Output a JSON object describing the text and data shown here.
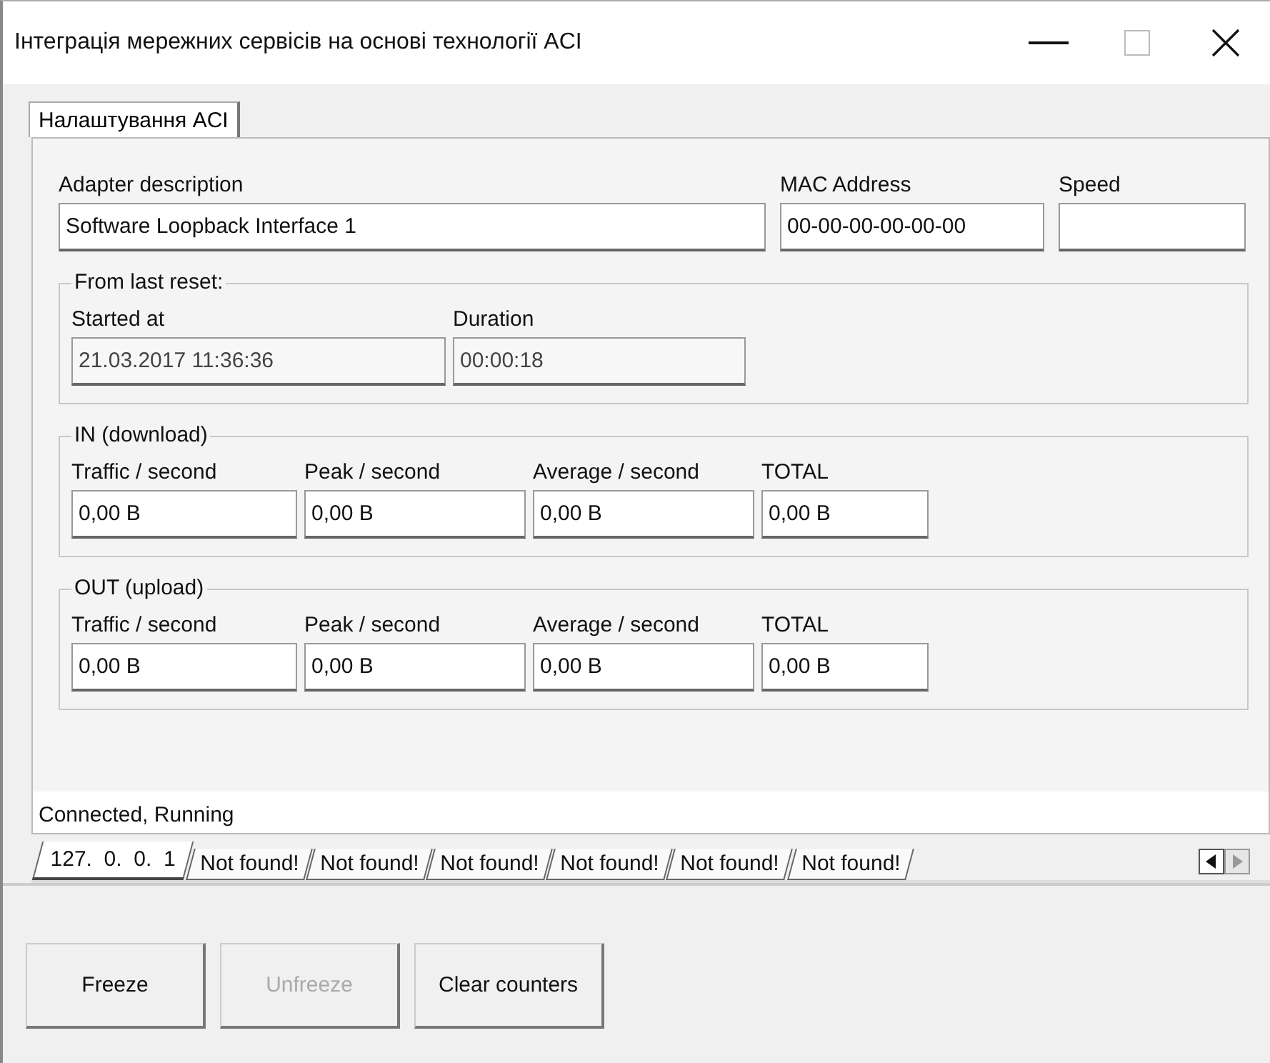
{
  "window": {
    "title": "Інтеграція мережних сервісів на основі технології ACI"
  },
  "tabs": [
    {
      "label": "Налаштування ACI",
      "selected": true
    }
  ],
  "adapter": [
    {
      "label": "Adapter description",
      "value": "Software Loopback Interface 1"
    },
    {
      "label": "MAC Address",
      "value": "00-00-00-00-00-00"
    },
    {
      "label": "Speed"
    }
  ],
  "groups": [
    {
      "kind": "reset",
      "title": "From last reset:",
      "fields": [
        {
          "label": "Started at",
          "value": "21.03.2017 11:36:36",
          "disabled": true
        },
        {
          "label": "Duration",
          "value": "00:00:18",
          "disabled": true
        }
      ]
    },
    {
      "kind": "traffic",
      "title": "IN (download)",
      "fields": [
        {
          "label": "Traffic / second",
          "value": "0,00 B",
          "disabled": false
        },
        {
          "label": "Peak / second",
          "value": "0,00 B",
          "disabled": false
        },
        {
          "label": "Average / second",
          "value": "0,00 B",
          "disabled": false
        },
        {
          "label": "TOTAL",
          "value": "0,00 B",
          "disabled": false
        }
      ]
    },
    {
      "kind": "traffic",
      "title": "OUT (upload)",
      "fields": [
        {
          "label": "Traffic / second",
          "value": "0,00 B",
          "disabled": false
        },
        {
          "label": "Peak / second",
          "value": "0,00 B",
          "disabled": false
        },
        {
          "label": "Average / second",
          "value": "0,00 B",
          "disabled": false
        },
        {
          "label": "TOTAL",
          "value": "0,00 B",
          "disabled": false
        }
      ]
    }
  ],
  "status": "Connected, Running",
  "interface_tabs": [
    {
      "label": "127.  0.  0.  1",
      "selected": true
    },
    {
      "label": "Not found!",
      "selected": false
    },
    {
      "label": "Not found!",
      "selected": false
    },
    {
      "label": "Not found!",
      "selected": false
    },
    {
      "label": "Not found!",
      "selected": false
    },
    {
      "label": "Not found!",
      "selected": false
    },
    {
      "label": "Not found!",
      "selected": false
    }
  ],
  "buttons": [
    {
      "label": "Freeze",
      "disabled": false
    },
    {
      "label": "Unfreeze",
      "disabled": true
    },
    {
      "label": "Clear counters",
      "disabled": false
    }
  ]
}
